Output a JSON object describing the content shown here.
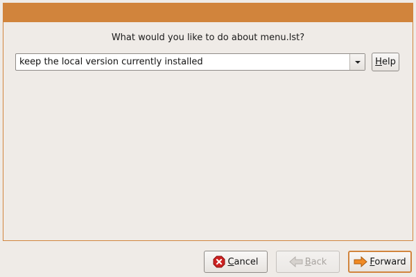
{
  "dialog": {
    "question": "What would you like to do about menu.lst?"
  },
  "combo": {
    "selected": "keep the local version currently installed"
  },
  "buttons": {
    "help": "Help",
    "cancel": "Cancel",
    "back": "Back",
    "forward": "Forward"
  },
  "icons": {
    "cancel": "cancel-icon",
    "back": "arrow-left-icon",
    "forward": "arrow-right-icon",
    "combo_arrow": "chevron-down-icon"
  },
  "colors": {
    "accent": "#d1843c",
    "background": "#efebe7",
    "cancel_red": "#cc2222"
  }
}
